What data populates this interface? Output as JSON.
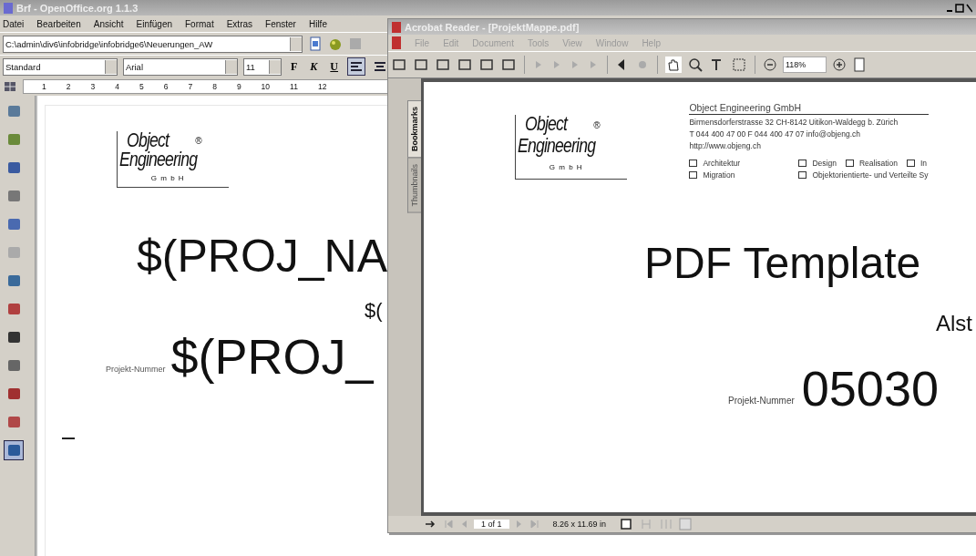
{
  "writer": {
    "title": "Brf - OpenOffice.org 1.1.3",
    "menu": [
      "Datei",
      "Bearbeiten",
      "Ansicht",
      "Einfügen",
      "Format",
      "Extras",
      "Fenster",
      "Hilfe"
    ],
    "url": "C:\\admin\\div6\\infobridge\\infobridge6\\Neuerungen_AW",
    "paragraph_style": "Standard",
    "font": "Arial",
    "font_size": "11",
    "format_buttons": [
      "F",
      "K",
      "U"
    ],
    "align_buttons": [
      {
        "selected": true
      },
      {
        "selected": false
      }
    ],
    "ruler": [
      "1",
      "2",
      "3",
      "4",
      "5",
      "6",
      "7",
      "8",
      "9",
      "10",
      "11",
      "12"
    ],
    "side_tools": [
      {
        "selected": false
      },
      {
        "selected": false
      },
      {
        "selected": false
      },
      {
        "selected": false
      },
      {
        "selected": false
      },
      {
        "selected": false
      },
      {
        "selected": false
      },
      {
        "selected": false
      },
      {
        "selected": false
      },
      {
        "selected": false
      },
      {
        "selected": false
      },
      {
        "selected": false
      },
      {
        "selected": true
      }
    ],
    "document": {
      "logo": {
        "line1": "Object",
        "line2": "Engineering",
        "mark": "®",
        "sub": "G m b H"
      },
      "title": "$(PROJ_NA",
      "subtitle": "$(",
      "number_label": "Projekt-Nummer",
      "number": "$(PROJ_"
    }
  },
  "reader": {
    "title": "Acrobat Reader - [ProjektMappe.pdf]",
    "menu": [
      "File",
      "Edit",
      "Document",
      "Tools",
      "View",
      "Window",
      "Help"
    ],
    "zoom": "118%",
    "side_tabs": [
      {
        "label": "Bookmarks",
        "selected": true
      },
      {
        "label": "Thumbnails",
        "selected": false
      }
    ],
    "page": {
      "logo": {
        "line1": "Object",
        "line2": "Engineering",
        "mark": "®",
        "sub": "G m b H"
      },
      "company": "Object Engineering GmbH",
      "address": "Birmensdorferstrasse 32  CH-8142 Uitikon-Waldegg  b. Zürich",
      "contact": "T 044 400 47 00  F 044 400 47 07  info@objeng.ch",
      "web": "http://www.objeng.ch",
      "services": [
        [
          {
            "label": "Architektur",
            "checked": false
          },
          {
            "label": "Design",
            "checked": false
          },
          {
            "label": "Realisation",
            "checked": false
          },
          {
            "label": "In",
            "checked": false
          }
        ],
        [
          {
            "label": "Migration",
            "checked": false
          },
          {
            "label": "Objektorientierte- und Verteilte Sy",
            "checked": false
          }
        ]
      ],
      "title": "PDF Template",
      "subtitle": "Alst",
      "number_label": "Projekt-Nummer",
      "number": "05030"
    },
    "status": {
      "page": "1 of 1",
      "size": "8.26 x 11.69 in"
    }
  }
}
